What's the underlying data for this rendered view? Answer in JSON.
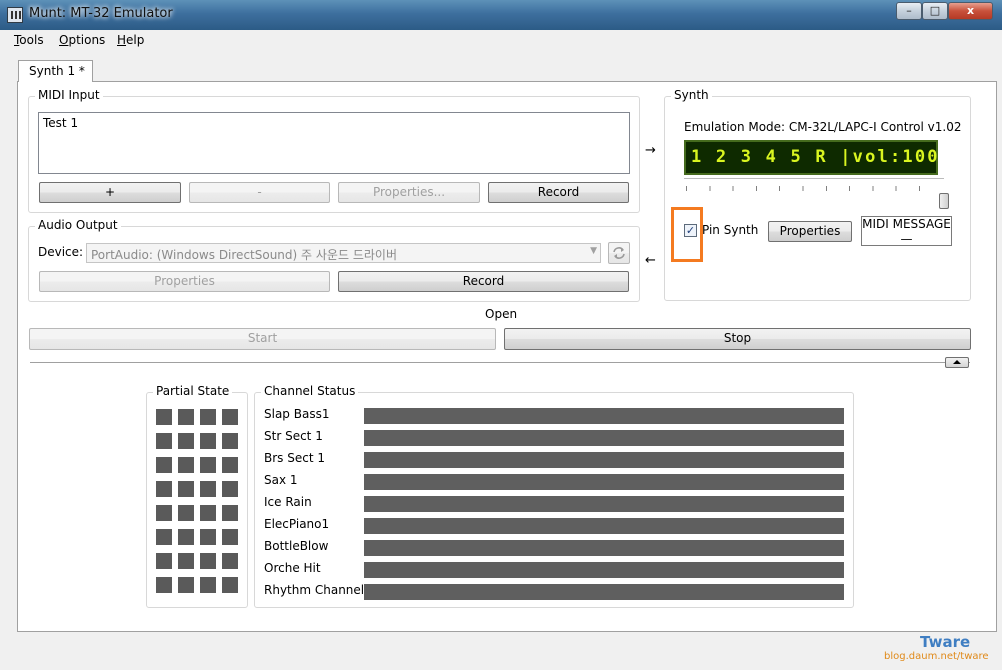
{
  "window": {
    "title": "Munt: MT-32 Emulator",
    "minimize": "–",
    "maximize": "□",
    "close": "x"
  },
  "menu": [
    {
      "label_u": "T",
      "label_rest": "ools"
    },
    {
      "label_u": "O",
      "label_rest": "ptions"
    },
    {
      "label_u": "H",
      "label_rest": "elp"
    }
  ],
  "tab": {
    "label": "Synth 1 *"
  },
  "midi_input": {
    "group_label": "MIDI Input",
    "items": [
      "Test 1"
    ],
    "add": "+",
    "remove": "-",
    "properties": "Properties...",
    "record": "Record"
  },
  "audio_output": {
    "group_label": "Audio Output",
    "device_label": "Device:",
    "device_value": "PortAudio: (Windows DirectSound) 주 사운드 드라이버",
    "properties": "Properties",
    "record": "Record"
  },
  "arrows": {
    "right": "→",
    "left": "←"
  },
  "synth": {
    "group_label": "Synth",
    "emulation_mode": "Emulation Mode: CM-32L/LAPC-I Control v1.02",
    "lcd_text": "1 2 3 4 5 R |vol:100",
    "volume_level": 1.0,
    "pin_label": "Pin Synth",
    "pin_checked": true,
    "properties": "Properties",
    "midi_message": "MIDI MESSAGE\n—"
  },
  "status": {
    "open": "Open"
  },
  "controls": {
    "start": "Start",
    "stop": "Stop"
  },
  "partial_state": {
    "label": "Partial State",
    "rows": 8,
    "cols": 4
  },
  "channel_status": {
    "label": "Channel Status",
    "channels": [
      "Slap Bass1",
      "Str Sect 1",
      "Brs Sect 1",
      "Sax 1",
      "Ice Rain",
      "ElecPiano1",
      "BottleBlow",
      "Orche Hit",
      "Rhythm Channel"
    ]
  },
  "watermark": {
    "brand": "Tware",
    "url": "blog.daum.net/tware"
  },
  "colors": {
    "lcd_bg": "#0e2a00",
    "lcd_fg": "#d9f520",
    "highlight": "#f47a20",
    "bar": "#5f5f5f",
    "partial": "#5a5a5a"
  }
}
